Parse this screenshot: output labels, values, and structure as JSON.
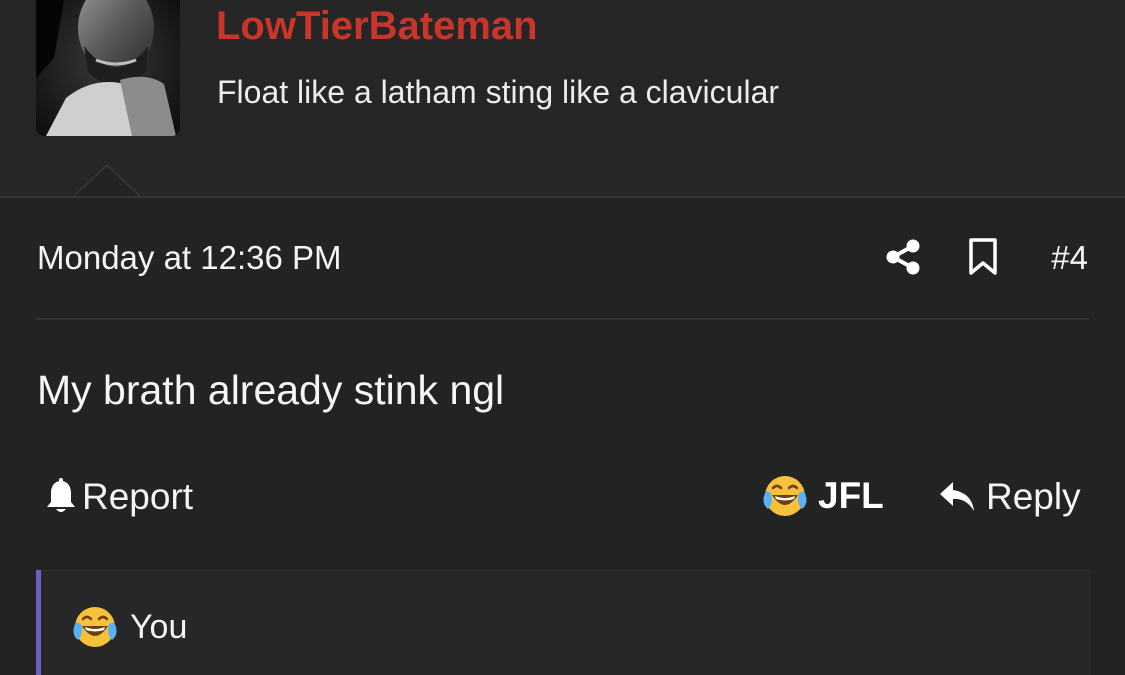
{
  "user": {
    "username": "LowTierBateman",
    "username_color": "#c9342b",
    "title": "Float like a latham sting like a clavicular",
    "avatar_icon": "user-avatar"
  },
  "post": {
    "date": "Monday at 12:36 PM",
    "number": "#4",
    "share_icon": "share-icon",
    "bookmark_icon": "bookmark-icon",
    "body": "My brath already stink ngl"
  },
  "actions": {
    "report_label": "Report",
    "reaction_label": "JFL",
    "reaction_emoji": "crying-laughing-emoji",
    "reply_label": "Reply"
  },
  "reactions_summary": {
    "label": "You",
    "emoji": "crying-laughing-emoji",
    "accent_color": "#6a63c2"
  }
}
